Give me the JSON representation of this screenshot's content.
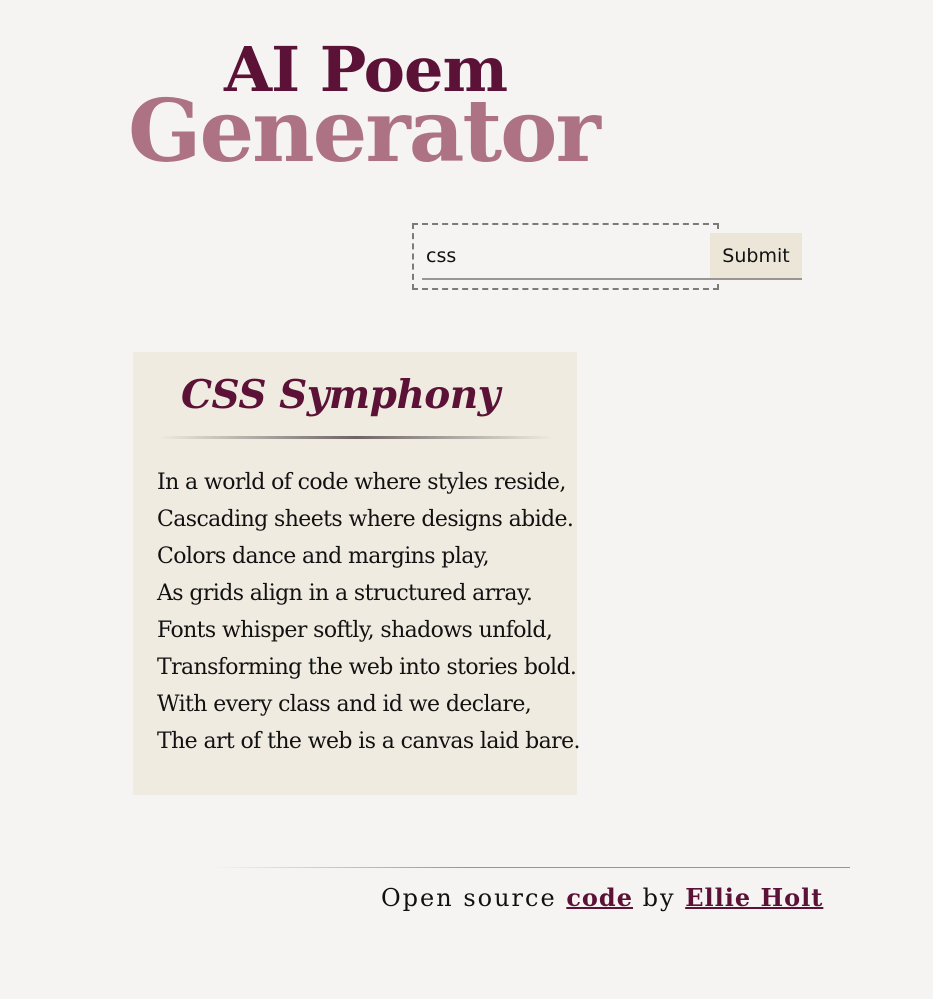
{
  "header": {
    "title_line1": "AI Poem",
    "title_line2": "Generator"
  },
  "form": {
    "input_value": "css",
    "submit_label": "Submit"
  },
  "poem": {
    "title": "CSS Symphony",
    "lines": [
      "In a world of code where styles reside,",
      "Cascading sheets where designs abide.",
      "Colors dance and margins play,",
      "As grids align in a structured array.",
      "Fonts whisper softly, shadows unfold,",
      "Transforming the web into stories bold.",
      "With every class and id we declare,",
      "The art of the web is a canvas laid bare."
    ]
  },
  "footer": {
    "prefix": "Open source",
    "code_link": "code",
    "by_word": "by",
    "author_link": "Ellie Holt"
  },
  "colors": {
    "background": "#f6f4f2",
    "title_primary": "#5b1236",
    "title_secondary": "#ad7384",
    "card_background": "#f0ebe1",
    "button_background": "#ece6d9"
  }
}
